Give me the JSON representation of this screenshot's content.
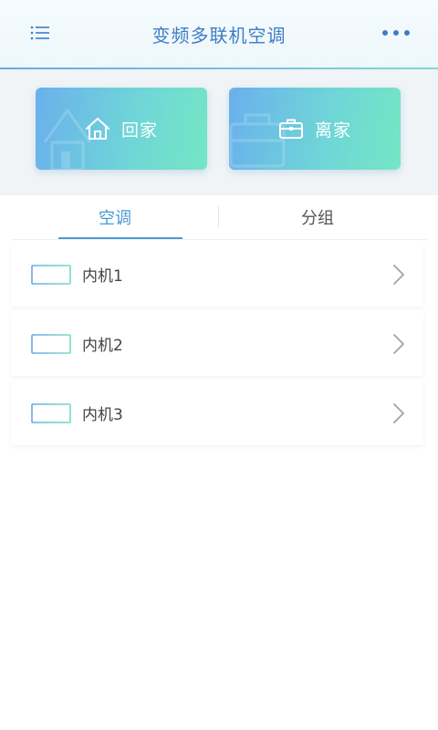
{
  "header": {
    "title": "变频多联机空调",
    "menu_icon": "list-menu-icon",
    "more_icon": "more-dots-icon"
  },
  "modes": {
    "home": {
      "label": "回家",
      "icon": "house-icon"
    },
    "away": {
      "label": "离家",
      "icon": "briefcase-icon"
    }
  },
  "tabs": [
    {
      "label": "空调",
      "active": true
    },
    {
      "label": "分组",
      "active": false
    }
  ],
  "units": [
    {
      "name": "内机1"
    },
    {
      "name": "内机2"
    },
    {
      "name": "内机3"
    }
  ],
  "colors": {
    "accent": "#4a9ad6",
    "title": "#3e7ec4",
    "gradient_start": "#6ab0ec",
    "gradient_end": "#74e6c4"
  }
}
